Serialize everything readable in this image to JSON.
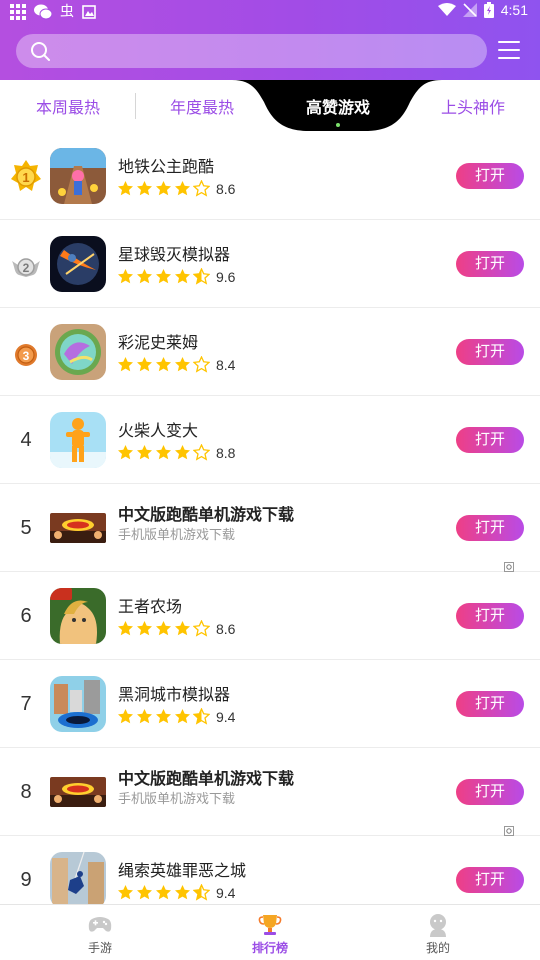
{
  "status_bar": {
    "time": "4:51",
    "left_icons": [
      "grid-app-icon",
      "wechat-icon",
      "notification-icon",
      "image-icon"
    ],
    "right_icons": [
      "wifi-icon",
      "signal-icon",
      "battery-icon"
    ]
  },
  "search": {
    "placeholder": "",
    "value": ""
  },
  "tabs": [
    {
      "label": "本周最热",
      "active": false
    },
    {
      "label": "年度最热",
      "active": false
    },
    {
      "label": "高赞游戏",
      "active": true
    },
    {
      "label": "上头神作",
      "active": false
    }
  ],
  "list": [
    {
      "rank": "1",
      "name": "地铁公主跑酷",
      "rating": 4,
      "score": "8.6",
      "button": "打开",
      "icon": "subway-runner-icon"
    },
    {
      "rank": "2",
      "name": "星球毁灭模拟器",
      "rating": 4.5,
      "score": "9.6",
      "button": "打开",
      "icon": "planet-destroy-icon"
    },
    {
      "rank": "3",
      "name": "彩泥史莱姆",
      "rating": 4,
      "score": "8.4",
      "button": "打开",
      "icon": "slime-icon"
    },
    {
      "rank": "4",
      "name": "火柴人变大",
      "rating": 4,
      "score": "8.8",
      "button": "打开",
      "icon": "stickman-icon"
    },
    {
      "rank": "5",
      "name": "中文版跑酷单机游戏下载",
      "subtitle": "手机版单机游戏下载",
      "button": "打开",
      "icon": "runner-banner-icon",
      "ad": true
    },
    {
      "rank": "6",
      "name": "王者农场",
      "rating": 4,
      "score": "8.6",
      "button": "打开",
      "icon": "king-farm-icon"
    },
    {
      "rank": "7",
      "name": "黑洞城市模拟器",
      "rating": 4.5,
      "score": "9.4",
      "button": "打开",
      "icon": "blackhole-city-icon"
    },
    {
      "rank": "8",
      "name": "中文版跑酷单机游戏下载",
      "subtitle": "手机版单机游戏下载",
      "button": "打开",
      "icon": "runner-banner-icon",
      "ad": true
    },
    {
      "rank": "9",
      "name": "绳索英雄罪恶之城",
      "rating": 4.5,
      "score": "9.4",
      "button": "打开",
      "icon": "rope-hero-icon"
    }
  ],
  "bottom_nav": [
    {
      "label": "手游",
      "icon": "gamepad-icon",
      "active": false
    },
    {
      "label": "排行榜",
      "icon": "trophy-icon",
      "active": true
    },
    {
      "label": "我的",
      "icon": "profile-icon",
      "active": false
    }
  ],
  "colors": {
    "header_gradient_start": "#b44fe0",
    "header_gradient_end": "#8f53ef",
    "accent_purple": "#9b4de6",
    "button_gradient_start": "#ee3f86",
    "button_gradient_end": "#b94be6",
    "star_yellow": "#ffc400",
    "gold": "#f5b400",
    "silver": "#b9b9b9",
    "bronze": "#e07a2c"
  }
}
